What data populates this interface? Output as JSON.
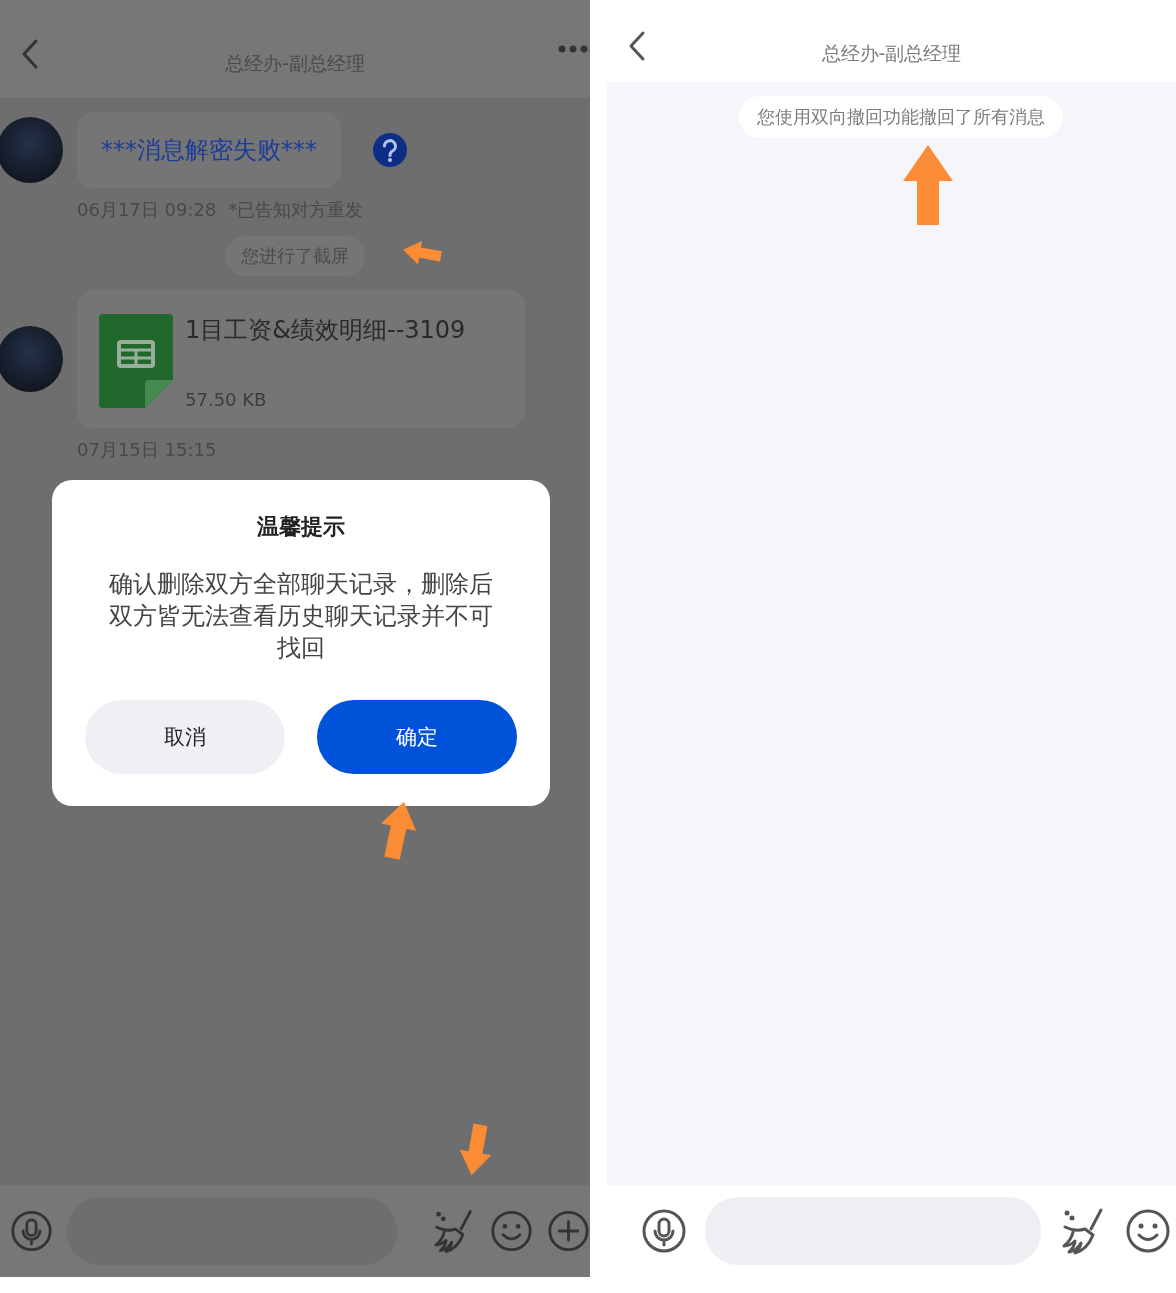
{
  "left_screen": {
    "title": "总经办-副总经理",
    "messages": [
      {
        "kind": "text",
        "text": "***消息解密失败***",
        "failed": true,
        "time": "06月17日 09:28",
        "note": "*已告知对方重发"
      },
      {
        "kind": "system",
        "text": "您进行了截屏"
      },
      {
        "kind": "file",
        "name": "1目工资&绩效明细--3109",
        "size": "57.50 KB",
        "time": "07月15日 15:15"
      }
    ],
    "dialog": {
      "title": "温馨提示",
      "body": "确认删除双方全部聊天记录，删除后双方皆无法查看历史聊天记录并不可找回",
      "buttons": [
        {
          "label": "取消",
          "primary": false
        },
        {
          "label": "确定",
          "primary": true
        }
      ]
    }
  },
  "right_screen": {
    "title": "总经办-副总经理",
    "messages": [
      {
        "kind": "system",
        "text": "您使用双向撤回功能撤回了所有消息"
      }
    ]
  }
}
